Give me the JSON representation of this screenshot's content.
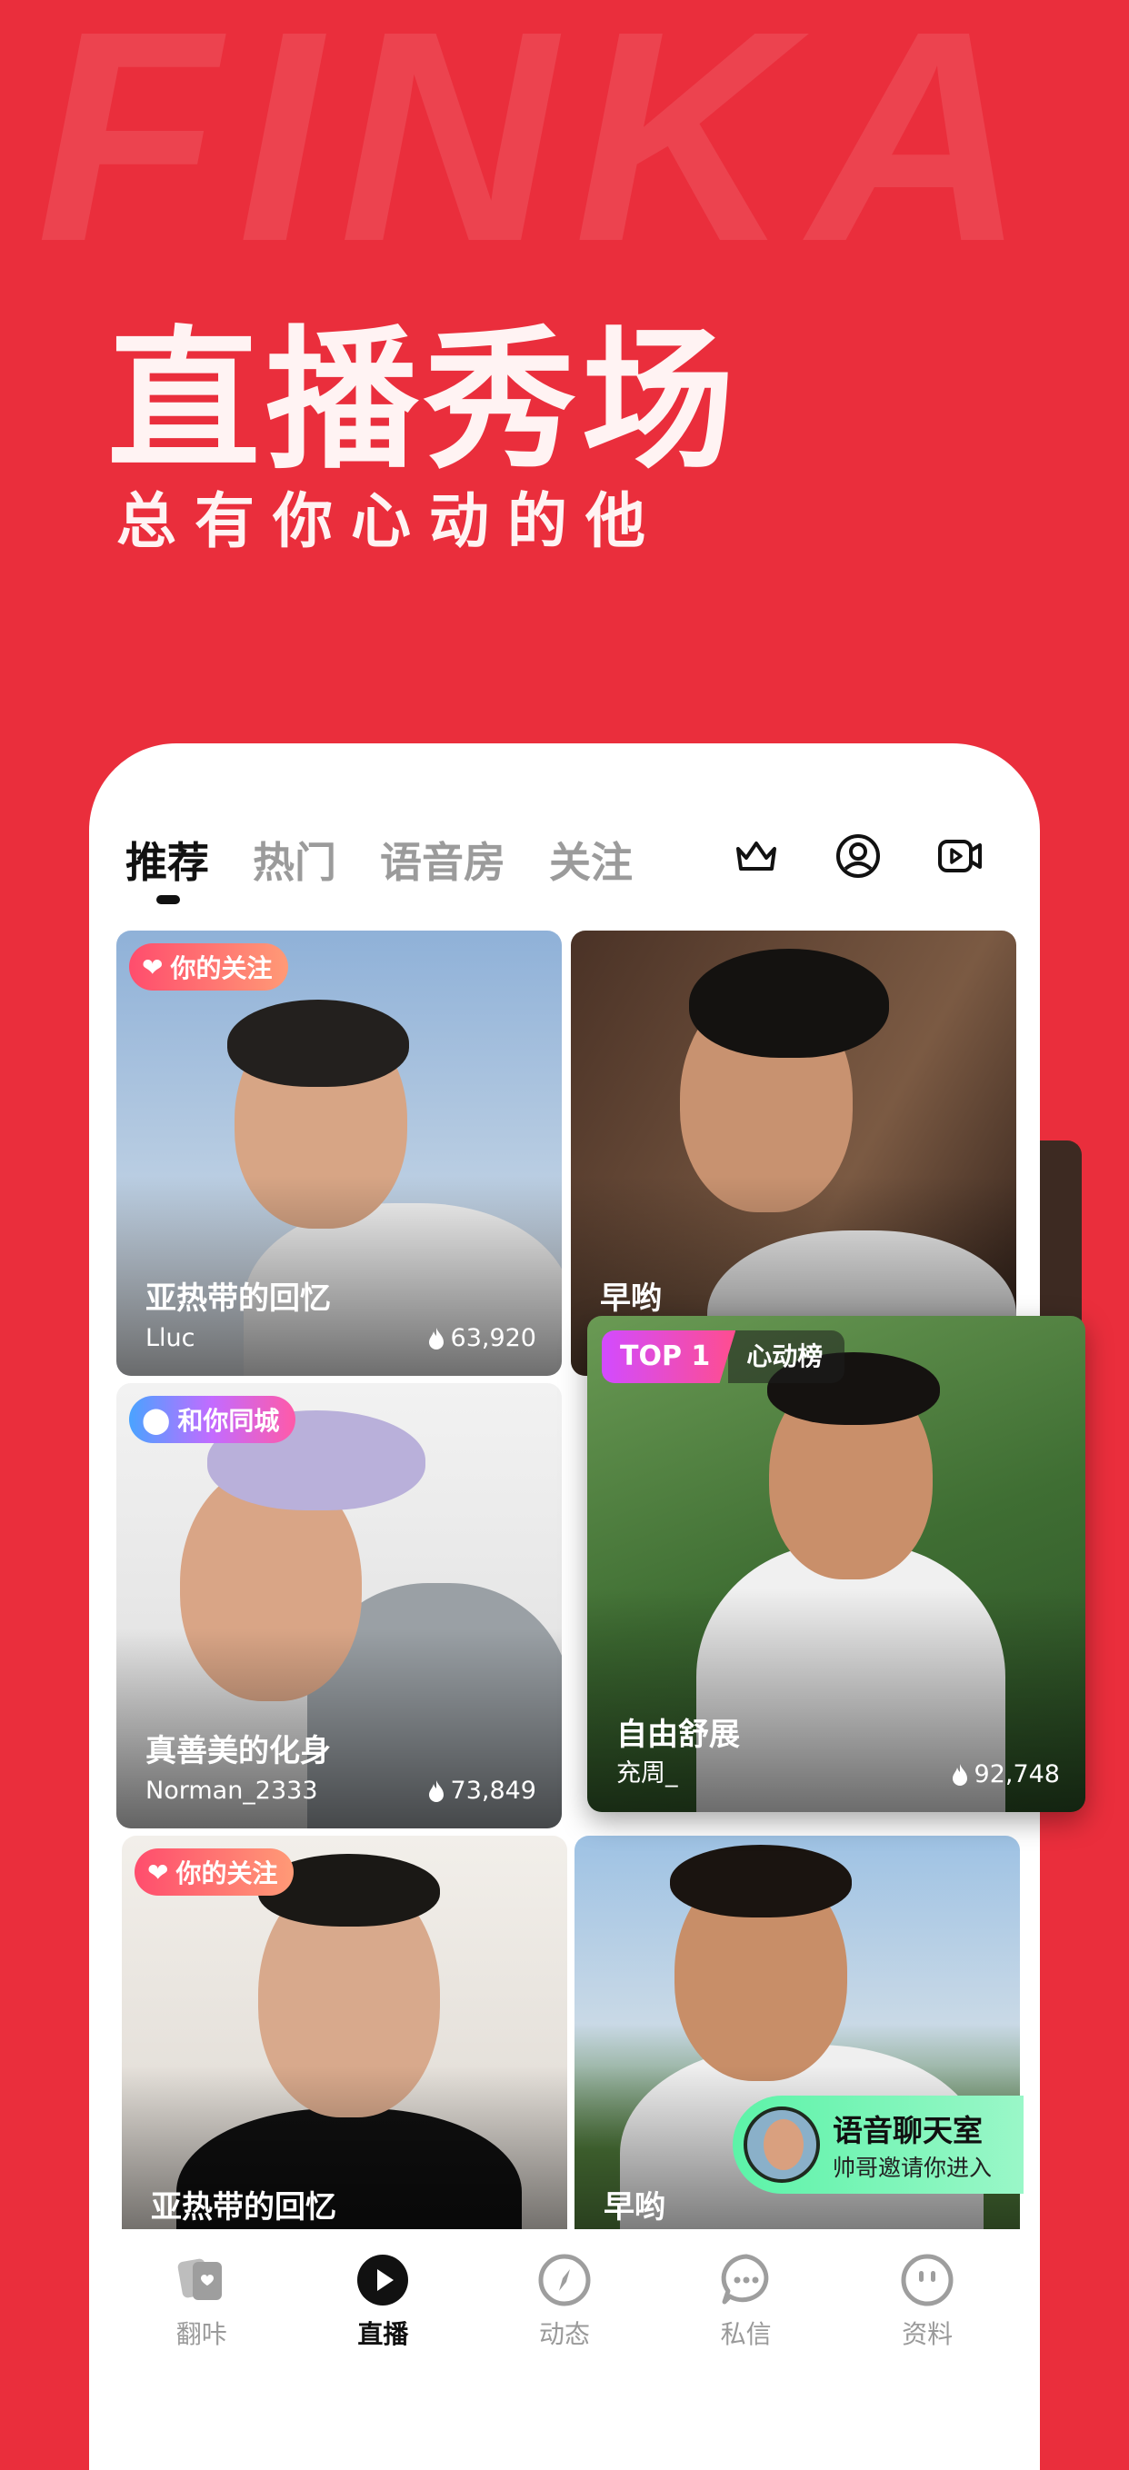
{
  "hero": {
    "bg_word": "FINKA",
    "title": "直播秀场",
    "subtitle": "总有你心动的他"
  },
  "tabs": [
    {
      "label": "推荐",
      "active": true
    },
    {
      "label": "热门",
      "active": false
    },
    {
      "label": "语音房",
      "active": false
    },
    {
      "label": "关注",
      "active": false
    }
  ],
  "top_icons": [
    "crown-icon",
    "profile-icon",
    "video-camera-icon"
  ],
  "cards": [
    {
      "badge": "你的关注",
      "badge_icon": "heart-icon",
      "title": "亚热带的回忆",
      "user": "Lluc",
      "heat": "63,920"
    },
    {
      "title": "早哟"
    },
    {
      "badge": "和你同城",
      "badge_icon": "location-pin-icon",
      "title": "真善美的化身",
      "user": "Norman_2333",
      "heat": "73,849"
    },
    {
      "badge_rank": "TOP 1",
      "badge_list": "心动榜",
      "title": "自由舒展",
      "user": "充周_",
      "heat": "92,748"
    },
    {
      "badge": "你的关注",
      "badge_icon": "heart-icon",
      "title": "亚热带的回忆"
    },
    {
      "title": "早哟"
    }
  ],
  "voice_room": {
    "title": "语音聊天室",
    "subtitle": "帅哥邀请你进入"
  },
  "nav": [
    {
      "label": "翻咔",
      "icon": "cards-icon",
      "active": false
    },
    {
      "label": "直播",
      "icon": "live-play-icon",
      "active": true
    },
    {
      "label": "动态",
      "icon": "compass-icon",
      "active": false
    },
    {
      "label": "私信",
      "icon": "chat-bubble-icon",
      "active": false
    },
    {
      "label": "资料",
      "icon": "profile-face-icon",
      "active": false
    }
  ],
  "colors": {
    "brand_red": "#ea2e3c",
    "voice_green": "#5cf3a8"
  }
}
